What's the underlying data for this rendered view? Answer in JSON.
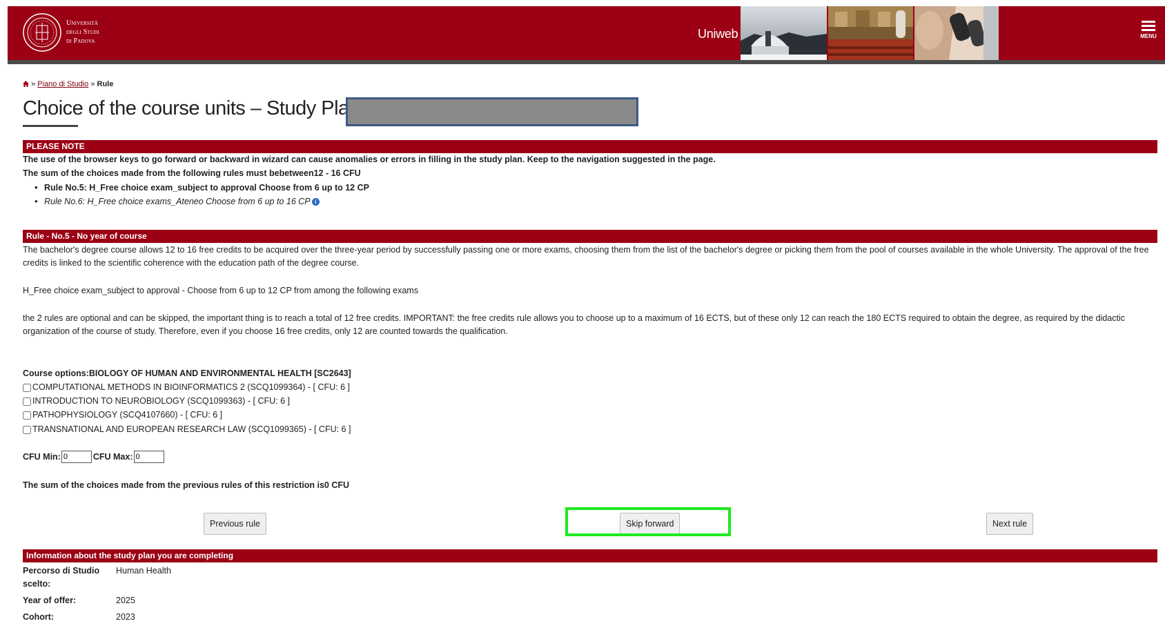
{
  "header": {
    "university_line1": "Università",
    "university_line2": "degli Studi",
    "university_line3": "di Padova",
    "app_name": "Uniweb",
    "menu_label": "MENU",
    "brand_color": "#9b0014"
  },
  "breadcrumb": {
    "home_icon": "home-icon",
    "sep1": "»",
    "link": "Piano di Studio",
    "sep2": "»",
    "current": "Rule"
  },
  "title": "Choice of the course units – Study Plan of",
  "please_note": {
    "heading": "PLEASE NOTE",
    "warning": "The use of the browser keys to go forward or backward in wizard can cause anomalies or errors in filling in the study plan. Keep to the navigation suggested in the page.",
    "sum_rule": "The sum of the choices made from the following rules must bebetween12 - 16 CFU",
    "rules": [
      "Rule No.5: H_Free choice exam_subject to approval Choose from 6 up to 12 CP",
      "Rule No.6: H_Free choice exams_Ateneo Choose from 6 up to 16 CP"
    ]
  },
  "rule": {
    "heading": "Rule - No.5 - No year of course",
    "description": "The bachelor's degree course allows 12 to 16 free credits to be acquired over the three-year period by successfully passing one or more exams, choosing them from the list of the bachelor's degree or picking them from the pool of courses available in the whole University. The approval of the free credits is linked to the scientific coherence with the education path of the degree course.",
    "choose_line": "H_Free choice exam_subject to approval - Choose from 6 up to 12 CP from among the following exams",
    "note": "the 2 rules are optional and can be skipped, the important thing is to reach a total of 12 free credits. IMPORTANT: the free credits rule allows you to choose up to a maximum of 16 ECTS, but of these only 12 can reach the 180 ECTS required to obtain the degree, as required by the didactic organization of the course of study. Therefore, even if you choose 16 free credits, only 12 are counted towards the qualification.",
    "course_options_label": "Course options:BIOLOGY OF HUMAN AND ENVIRONMENTAL HEALTH [SC2643]",
    "courses": [
      "COMPUTATIONAL METHODS IN BIOINFORMATICS 2 (SCQ1099364) - [ CFU: 6 ]",
      "INTRODUCTION TO NEUROBIOLOGY (SCQ1099363) - [ CFU: 6 ]",
      "PATHOPHYSIOLOGY (SCQ4107660) - [ CFU: 6 ]",
      "TRANSNATIONAL AND EUROPEAN RESEARCH LAW (SCQ1099365) - [ CFU: 6 ]"
    ],
    "cfu_min_label": "CFU Min:",
    "cfu_min_value": "0",
    "cfu_max_label": "CFU Max:",
    "cfu_max_value": "0",
    "sum_previous": "The sum of the choices made from the previous rules of this restriction is0 CFU"
  },
  "buttons": {
    "previous": "Previous rule",
    "skip": "Skip forward",
    "next": "Next rule"
  },
  "info": {
    "heading": "Information about the study plan you are completing",
    "rows": [
      {
        "key": "Percorso di Studio scelto:",
        "value": "Human Health"
      },
      {
        "key": "Year of offer:",
        "value": "2025"
      },
      {
        "key": "Cohort:",
        "value": "2023"
      }
    ]
  }
}
